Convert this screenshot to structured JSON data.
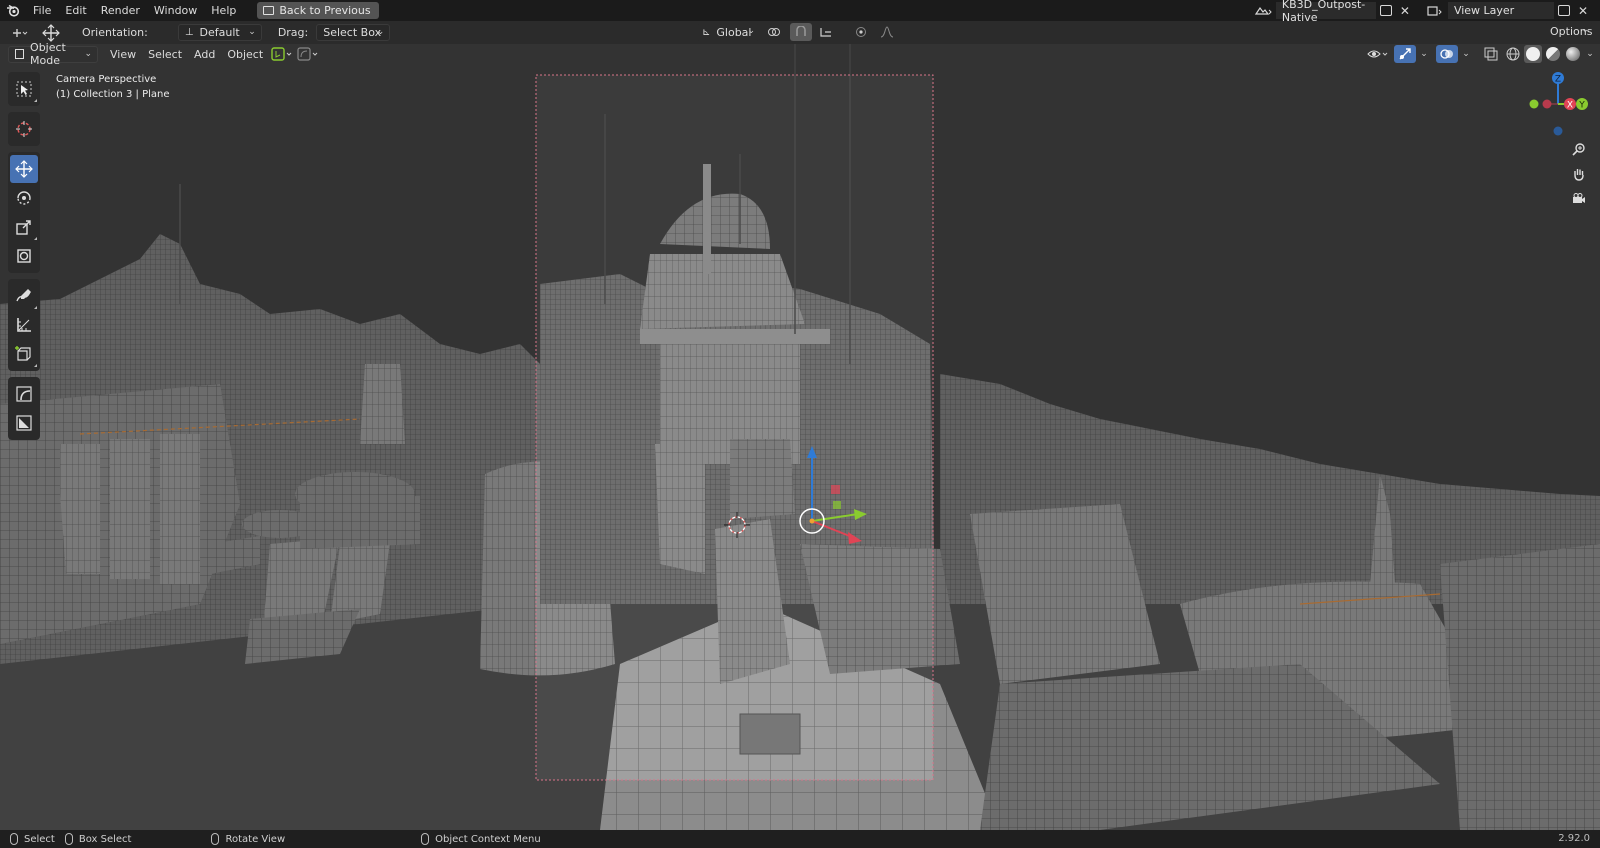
{
  "menubar": {
    "items": [
      "File",
      "Edit",
      "Render",
      "Window",
      "Help"
    ],
    "back_label": "Back to Previous",
    "scene_name": "KB3D_Outpost-Native",
    "view_layer": "View Layer"
  },
  "toolbar": {
    "orientation_label": "Orientation:",
    "orientation_value": "Default",
    "drag_label": "Drag:",
    "drag_value": "Select Box",
    "transform_orientation": "Global",
    "options_label": "Options"
  },
  "viewport_header": {
    "mode": "Object Mode",
    "menus": [
      "View",
      "Select",
      "Add",
      "Object"
    ]
  },
  "viewport": {
    "camera_label": "Camera Perspective",
    "collection_label": "(1) Collection 3 | Plane"
  },
  "gizmo": {
    "z": "Z",
    "x": "X",
    "y": "Y"
  },
  "statusbar": {
    "select": "Select",
    "box_select": "Box Select",
    "rotate_view": "Rotate View",
    "context_menu": "Object Context Menu",
    "version": "2.92.0"
  },
  "colors": {
    "accent": "#4772b3",
    "axis_x": "#e04455",
    "axis_y": "#8acb2f",
    "axis_z": "#2f7bd6",
    "camera_frame": "#d9748a"
  }
}
